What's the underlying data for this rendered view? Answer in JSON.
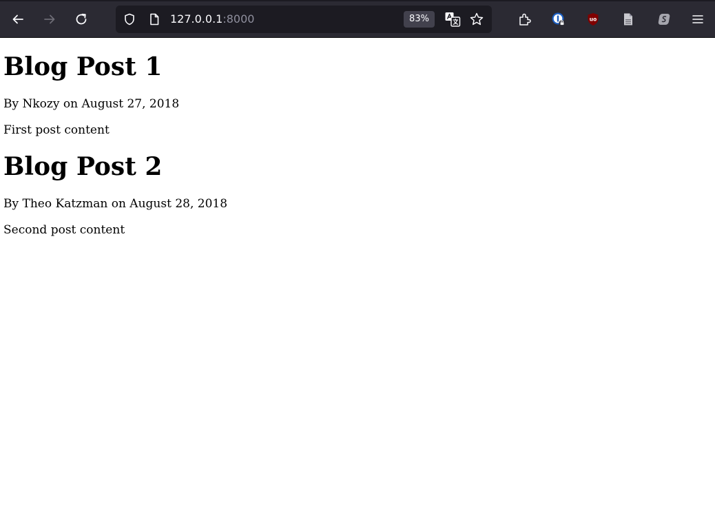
{
  "browser": {
    "url_host": "127.0.0.1",
    "url_port": ":8000",
    "zoom_level": "83%",
    "icons": {
      "back": "arrow-left-icon",
      "forward": "arrow-right-icon",
      "reload": "reload-icon",
      "tracking_protection": "shield-icon",
      "page_info": "page-icon",
      "translate": "translate-icon",
      "bookmark": "star-icon",
      "extensions": "puzzle-icon",
      "password_manager": "password-manager-icon",
      "ublock": "ublock-origin-icon",
      "reader": "document-icon",
      "surfshark": "vpn-icon",
      "menu": "hamburger-menu-icon"
    },
    "colors": {
      "toolbar": "#2b2a33",
      "urlbar": "#1c1b22",
      "ublock_red": "#800000"
    }
  },
  "posts": [
    {
      "title": "Blog Post 1",
      "meta": "By Nkozy on August 27, 2018",
      "body": "First post content"
    },
    {
      "title": "Blog Post 2",
      "meta": "By Theo Katzman on August 28, 2018",
      "body": "Second post content"
    }
  ]
}
